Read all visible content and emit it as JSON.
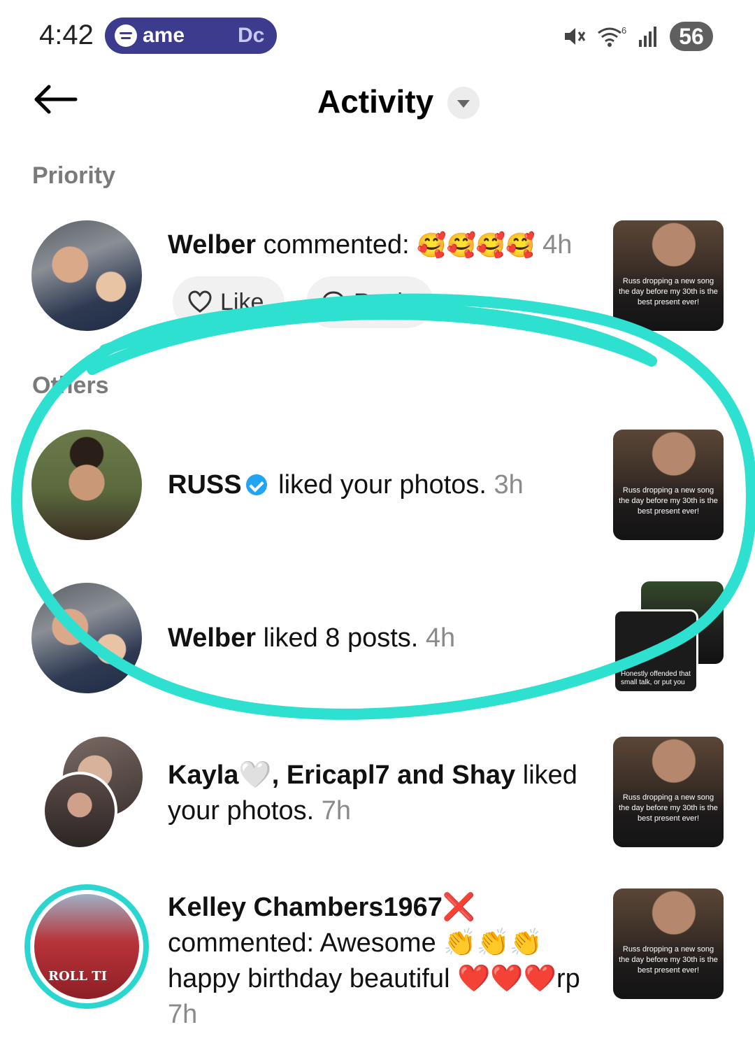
{
  "status_bar": {
    "time": "4:42",
    "media_title": "ame",
    "media_subtitle": "Dc",
    "battery": "56",
    "signal_label": "6"
  },
  "header": {
    "title": "Activity"
  },
  "sections": {
    "priority": "Priority",
    "others": "Others"
  },
  "priority_item": {
    "name": "Welber",
    "action": " commented: ",
    "emojis": "🥰🥰🥰🥰",
    "time": "4h",
    "like_label": "Like",
    "reply_label": "Reply",
    "thumb_caption": "Russ dropping a new song the day before my 30th is the best present ever!"
  },
  "others": [
    {
      "name": "RUSS",
      "action": " liked your photos.",
      "time": "3h",
      "thumb_caption": "Russ dropping a new song the day before my 30th is the best present ever!"
    },
    {
      "name": "Welber",
      "action": " liked 8 posts.",
      "time": "4h",
      "thumb_caption": "Honestly offended that small talk, or put you"
    },
    {
      "name": "Kayla🤍, Ericapl7 and Shay",
      "action_line1": " liked",
      "action_line2": "your photos.",
      "time": "7h",
      "thumb_caption": "Russ dropping a new song the day before my 30th is the best present ever!"
    },
    {
      "name": "Kelley Chambers1967❌",
      "line2": "commented: Awesome 👏👏👏",
      "line3": "happy birthday beautiful ❤️❤️❤️rp",
      "time": "7h",
      "avatar_text": "ROLL TI",
      "thumb_caption": "Russ dropping a new song the day before my 30th is the best present ever!"
    }
  ],
  "colors": {
    "highlight": "#2de0cf",
    "verified": "#20a4f3",
    "media_pill": "#3d3b8e",
    "ring": "#2ad6cf"
  },
  "icons": {
    "back": "back-arrow-icon",
    "dropdown": "chevron-down-icon",
    "mute": "mute-icon",
    "wifi": "wifi-icon",
    "signal": "signal-icon",
    "verified": "verified-icon",
    "like": "heart-outline-icon",
    "reply": "bubble-icon"
  }
}
